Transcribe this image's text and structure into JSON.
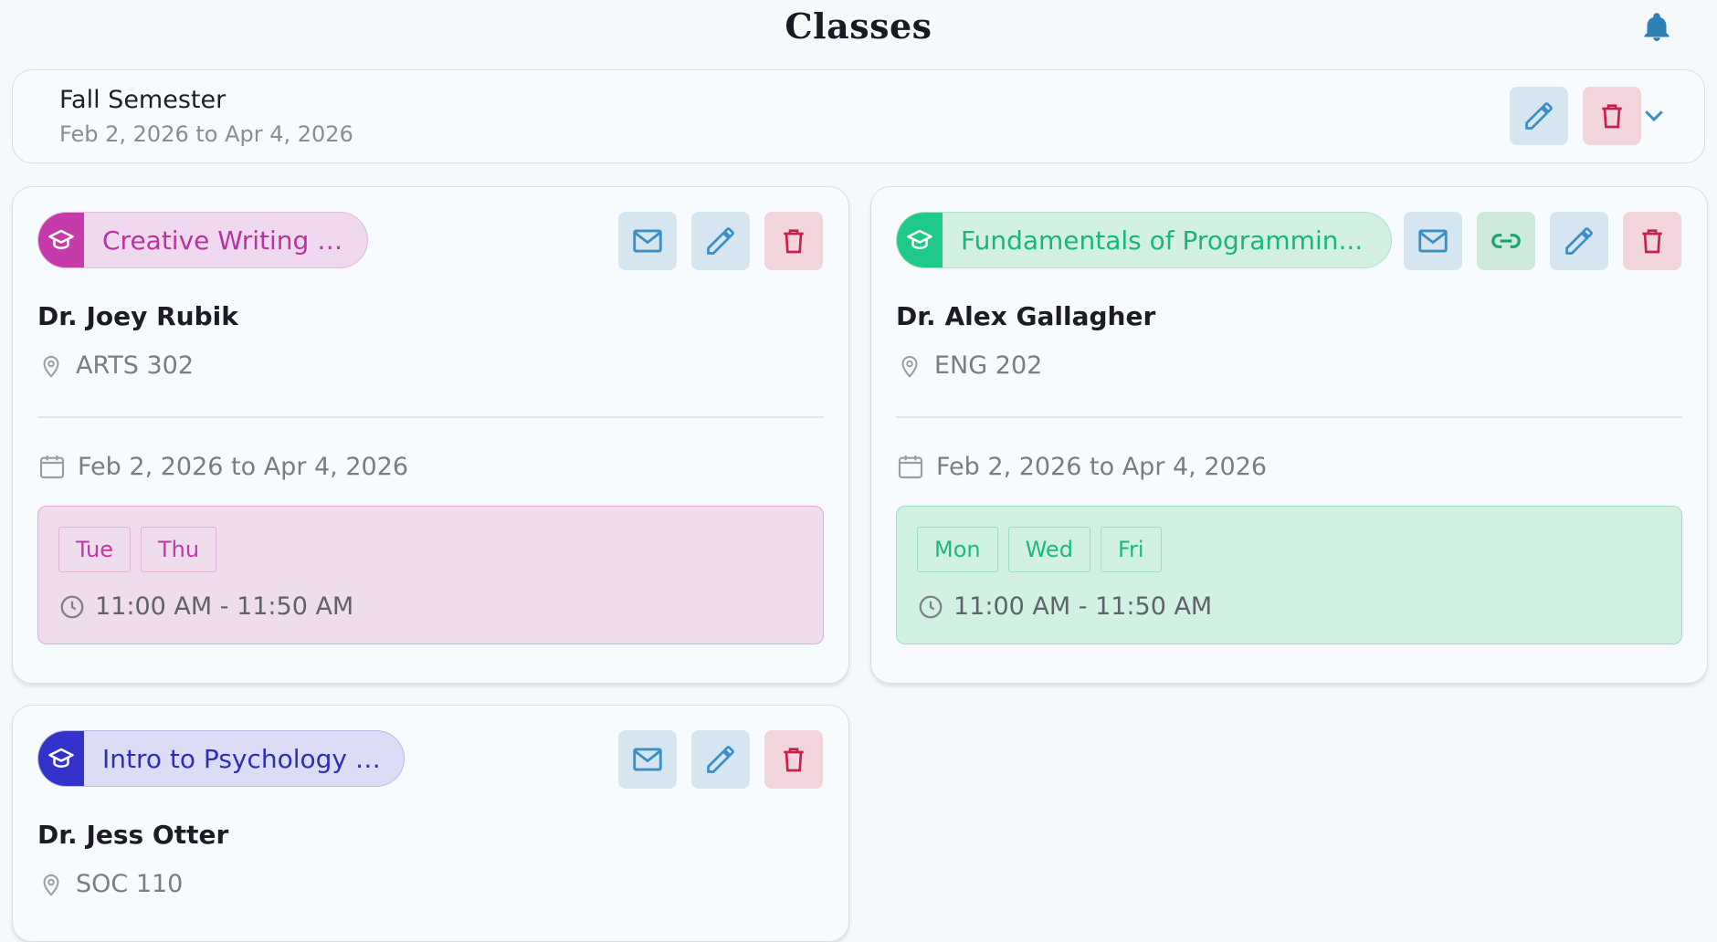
{
  "header": {
    "title": "Classes"
  },
  "semester": {
    "name": "Fall Semester",
    "range": "Feb 2, 2026 to Apr 4, 2026"
  },
  "classes": [
    {
      "name": "Creative Writing ✍️",
      "professor": "Dr. Joey Rubik",
      "room": "ARTS 302",
      "dates": "Feb 2, 2026 to Apr 4, 2026",
      "days": [
        "Tue",
        "Thu"
      ],
      "time": "11:00 AM - 11:50 AM",
      "accent": "#c53ba9"
    },
    {
      "name": "Fundamentals of Programmin...",
      "professor": "Dr. Alex Gallagher",
      "room": "ENG 202",
      "dates": "Feb 2, 2026 to Apr 4, 2026",
      "days": [
        "Mon",
        "Wed",
        "Fri"
      ],
      "time": "11:00 AM - 11:50 AM",
      "accent": "#1fc98a"
    },
    {
      "name": "Intro to Psychology 🧠",
      "professor": "Dr. Jess Otter",
      "room": "SOC 110",
      "accent": "#3333cc"
    }
  ],
  "colors": {
    "edit": "#3b8fc4",
    "delete": "#c8204a",
    "mail": "#3b8fc4",
    "link": "#16a76f"
  }
}
